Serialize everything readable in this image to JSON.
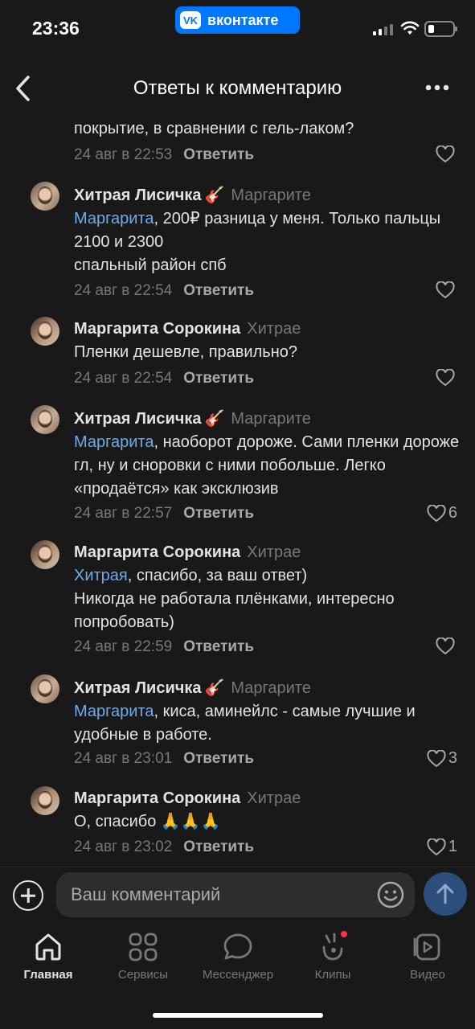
{
  "status_bar": {
    "time": "23:36",
    "app_badge": "вконтакте",
    "vk_logo": "vk-logo"
  },
  "header": {
    "title": "Ответы к комментарию"
  },
  "comments": [
    {
      "text": "покрытие, в сравнении с гель-лаком?",
      "date": "24 авг в 22:53",
      "reply_label": "Ответить",
      "likes": ""
    },
    {
      "author": "Хитрая Лисичка",
      "emoji": "🎸",
      "reply_to": "Маргарите",
      "mention": "Маргарита",
      "text": ", 200₽ разница у меня. Только пальцы 2100 и 2300",
      "text_line2": "спальный район спб",
      "date": "24 авг в 22:54",
      "reply_label": "Ответить",
      "likes": ""
    },
    {
      "author": "Маргарита Сорокина",
      "reply_to": "Хитрае",
      "text": "Пленки дешевле, правильно?",
      "date": "24 авг в 22:54",
      "reply_label": "Ответить",
      "likes": ""
    },
    {
      "author": "Хитрая Лисичка",
      "emoji": "🎸",
      "reply_to": "Маргарите",
      "mention": "Маргарита",
      "text": ", наоборот дороже. Сами пленки дороже гл, ну и сноровки с ними побольше. Легко «продаётся» как эксклюзив",
      "date": "24 авг в 22:57",
      "reply_label": "Ответить",
      "likes": "6"
    },
    {
      "author": "Маргарита Сорокина",
      "reply_to": "Хитрае",
      "mention": "Хитрая",
      "text": ", спасибо, за ваш ответ)",
      "text_line2": "Никогда не работала плёнками, интересно попробовать)",
      "date": "24 авг в 22:59",
      "reply_label": "Ответить",
      "likes": ""
    },
    {
      "author": "Хитрая Лисичка",
      "emoji": "🎸",
      "reply_to": "Маргарите",
      "mention": "Маргарита",
      "text": ", киса, аминейлс - самые лучшие и удобные в работе.",
      "date": "24 авг в 23:01",
      "reply_label": "Ответить",
      "likes": "3"
    },
    {
      "author": "Маргарита Сорокина",
      "reply_to": "Хитрае",
      "text": "О, спасибо 🙏🙏🙏",
      "date": "24 авг в 23:02",
      "reply_label": "Ответить",
      "likes": "1"
    }
  ],
  "composer": {
    "placeholder": "Ваш комментарий"
  },
  "tabs": [
    {
      "label": "Главная",
      "icon": "home-icon",
      "active": true
    },
    {
      "label": "Сервисы",
      "icon": "services-icon"
    },
    {
      "label": "Мессенджер",
      "icon": "messenger-icon"
    },
    {
      "label": "Клипы",
      "icon": "clips-icon"
    },
    {
      "label": "Видео",
      "icon": "video-icon"
    }
  ],
  "colors": {
    "background": "#191919",
    "accent": "#71aaeb",
    "vk_blue": "#0077ff",
    "notification_dot": "#ff3347"
  }
}
